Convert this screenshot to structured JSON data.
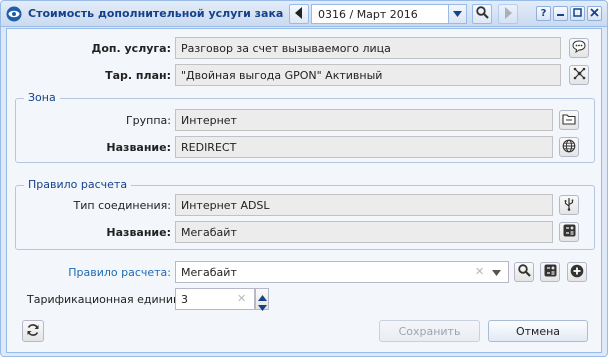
{
  "window": {
    "title": "Стоимость дополнительной услуги заказн...",
    "period": "0316 / Март 2016"
  },
  "service": {
    "dop_label": "Доп. услуга:",
    "dop_value": "Разговор за счет вызываемого лица",
    "plan_label": "Тар. план:",
    "plan_value": "\"Двойная выгода GPON\" Активный"
  },
  "zone": {
    "legend": "Зона",
    "group_label": "Группа:",
    "group_value": "Интернет",
    "name_label": "Название:",
    "name_value": "REDIRECT"
  },
  "rule": {
    "legend": "Правило расчета",
    "conn_label": "Тип соединения:",
    "conn_value": "Интернет ADSL",
    "name_label": "Название:",
    "name_value": "Мегабайт"
  },
  "calc": {
    "rule_label": "Правило расчета:",
    "rule_value": "Мегабайт",
    "unit_label": "Тарификационная единица:",
    "unit_value": "3"
  },
  "buttons": {
    "save": "Сохранить",
    "cancel": "Отмена"
  },
  "colors": {
    "accent": "#15428b",
    "link": "#1f6bb3",
    "border": "#99bbe8"
  }
}
